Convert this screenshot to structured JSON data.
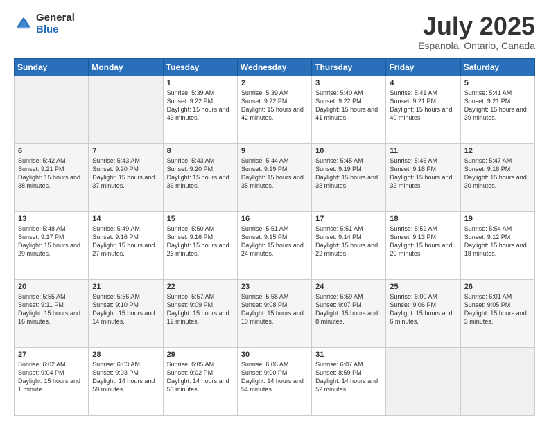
{
  "logo": {
    "general": "General",
    "blue": "Blue"
  },
  "title": "July 2025",
  "subtitle": "Espanola, Ontario, Canada",
  "days_header": [
    "Sunday",
    "Monday",
    "Tuesday",
    "Wednesday",
    "Thursday",
    "Friday",
    "Saturday"
  ],
  "weeks": [
    [
      {
        "day": "",
        "empty": true
      },
      {
        "day": "",
        "empty": true
      },
      {
        "day": "1",
        "sunrise": "Sunrise: 5:39 AM",
        "sunset": "Sunset: 9:22 PM",
        "daylight": "Daylight: 15 hours and 43 minutes."
      },
      {
        "day": "2",
        "sunrise": "Sunrise: 5:39 AM",
        "sunset": "Sunset: 9:22 PM",
        "daylight": "Daylight: 15 hours and 42 minutes."
      },
      {
        "day": "3",
        "sunrise": "Sunrise: 5:40 AM",
        "sunset": "Sunset: 9:22 PM",
        "daylight": "Daylight: 15 hours and 41 minutes."
      },
      {
        "day": "4",
        "sunrise": "Sunrise: 5:41 AM",
        "sunset": "Sunset: 9:21 PM",
        "daylight": "Daylight: 15 hours and 40 minutes."
      },
      {
        "day": "5",
        "sunrise": "Sunrise: 5:41 AM",
        "sunset": "Sunset: 9:21 PM",
        "daylight": "Daylight: 15 hours and 39 minutes."
      }
    ],
    [
      {
        "day": "6",
        "sunrise": "Sunrise: 5:42 AM",
        "sunset": "Sunset: 9:21 PM",
        "daylight": "Daylight: 15 hours and 38 minutes."
      },
      {
        "day": "7",
        "sunrise": "Sunrise: 5:43 AM",
        "sunset": "Sunset: 9:20 PM",
        "daylight": "Daylight: 15 hours and 37 minutes."
      },
      {
        "day": "8",
        "sunrise": "Sunrise: 5:43 AM",
        "sunset": "Sunset: 9:20 PM",
        "daylight": "Daylight: 15 hours and 36 minutes."
      },
      {
        "day": "9",
        "sunrise": "Sunrise: 5:44 AM",
        "sunset": "Sunset: 9:19 PM",
        "daylight": "Daylight: 15 hours and 35 minutes."
      },
      {
        "day": "10",
        "sunrise": "Sunrise: 5:45 AM",
        "sunset": "Sunset: 9:19 PM",
        "daylight": "Daylight: 15 hours and 33 minutes."
      },
      {
        "day": "11",
        "sunrise": "Sunrise: 5:46 AM",
        "sunset": "Sunset: 9:18 PM",
        "daylight": "Daylight: 15 hours and 32 minutes."
      },
      {
        "day": "12",
        "sunrise": "Sunrise: 5:47 AM",
        "sunset": "Sunset: 9:18 PM",
        "daylight": "Daylight: 15 hours and 30 minutes."
      }
    ],
    [
      {
        "day": "13",
        "sunrise": "Sunrise: 5:48 AM",
        "sunset": "Sunset: 9:17 PM",
        "daylight": "Daylight: 15 hours and 29 minutes."
      },
      {
        "day": "14",
        "sunrise": "Sunrise: 5:49 AM",
        "sunset": "Sunset: 9:16 PM",
        "daylight": "Daylight: 15 hours and 27 minutes."
      },
      {
        "day": "15",
        "sunrise": "Sunrise: 5:50 AM",
        "sunset": "Sunset: 9:16 PM",
        "daylight": "Daylight: 15 hours and 26 minutes."
      },
      {
        "day": "16",
        "sunrise": "Sunrise: 5:51 AM",
        "sunset": "Sunset: 9:15 PM",
        "daylight": "Daylight: 15 hours and 24 minutes."
      },
      {
        "day": "17",
        "sunrise": "Sunrise: 5:51 AM",
        "sunset": "Sunset: 9:14 PM",
        "daylight": "Daylight: 15 hours and 22 minutes."
      },
      {
        "day": "18",
        "sunrise": "Sunrise: 5:52 AM",
        "sunset": "Sunset: 9:13 PM",
        "daylight": "Daylight: 15 hours and 20 minutes."
      },
      {
        "day": "19",
        "sunrise": "Sunrise: 5:54 AM",
        "sunset": "Sunset: 9:12 PM",
        "daylight": "Daylight: 15 hours and 18 minutes."
      }
    ],
    [
      {
        "day": "20",
        "sunrise": "Sunrise: 5:55 AM",
        "sunset": "Sunset: 9:11 PM",
        "daylight": "Daylight: 15 hours and 16 minutes."
      },
      {
        "day": "21",
        "sunrise": "Sunrise: 5:56 AM",
        "sunset": "Sunset: 9:10 PM",
        "daylight": "Daylight: 15 hours and 14 minutes."
      },
      {
        "day": "22",
        "sunrise": "Sunrise: 5:57 AM",
        "sunset": "Sunset: 9:09 PM",
        "daylight": "Daylight: 15 hours and 12 minutes."
      },
      {
        "day": "23",
        "sunrise": "Sunrise: 5:58 AM",
        "sunset": "Sunset: 9:08 PM",
        "daylight": "Daylight: 15 hours and 10 minutes."
      },
      {
        "day": "24",
        "sunrise": "Sunrise: 5:59 AM",
        "sunset": "Sunset: 9:07 PM",
        "daylight": "Daylight: 15 hours and 8 minutes."
      },
      {
        "day": "25",
        "sunrise": "Sunrise: 6:00 AM",
        "sunset": "Sunset: 9:06 PM",
        "daylight": "Daylight: 15 hours and 6 minutes."
      },
      {
        "day": "26",
        "sunrise": "Sunrise: 6:01 AM",
        "sunset": "Sunset: 9:05 PM",
        "daylight": "Daylight: 15 hours and 3 minutes."
      }
    ],
    [
      {
        "day": "27",
        "sunrise": "Sunrise: 6:02 AM",
        "sunset": "Sunset: 9:04 PM",
        "daylight": "Daylight: 15 hours and 1 minute."
      },
      {
        "day": "28",
        "sunrise": "Sunrise: 6:03 AM",
        "sunset": "Sunset: 9:03 PM",
        "daylight": "Daylight: 14 hours and 59 minutes."
      },
      {
        "day": "29",
        "sunrise": "Sunrise: 6:05 AM",
        "sunset": "Sunset: 9:02 PM",
        "daylight": "Daylight: 14 hours and 56 minutes."
      },
      {
        "day": "30",
        "sunrise": "Sunrise: 6:06 AM",
        "sunset": "Sunset: 9:00 PM",
        "daylight": "Daylight: 14 hours and 54 minutes."
      },
      {
        "day": "31",
        "sunrise": "Sunrise: 6:07 AM",
        "sunset": "Sunset: 8:59 PM",
        "daylight": "Daylight: 14 hours and 52 minutes."
      },
      {
        "day": "",
        "empty": true
      },
      {
        "day": "",
        "empty": true
      }
    ]
  ]
}
